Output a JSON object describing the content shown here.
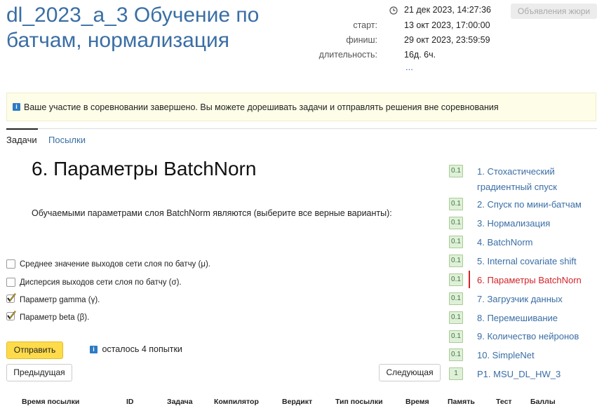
{
  "header": {
    "title": "dl_2023_a_3 Обучение по батчам, нормализация",
    "current_time": "21 дек 2023, 14:27:36",
    "start_label": "старт:",
    "start_value": "13 окт 2023, 17:00:00",
    "finish_label": "финиш:",
    "finish_value": "29 окт 2023, 23:59:59",
    "duration_label": "длительность:",
    "duration_value": "16д. 6ч.",
    "more": "...",
    "jury_button": "Объявления жюри"
  },
  "notice": {
    "text": "Ваше участие в соревновании завершено. Вы можете дорешивать задачи и отправлять решения вне соревнования"
  },
  "tabs": [
    {
      "label": "Задачи",
      "active": true
    },
    {
      "label": "Посылки",
      "active": false
    }
  ],
  "task": {
    "title": "6. Параметры BatchNorn",
    "question": "Обучаемыми параметрами слоя BatchNorm являются (выберите все верные варианты):",
    "options": [
      {
        "label": "Среднее значение выходов сети слоя по батчу (μ).",
        "checked": false
      },
      {
        "label": "Дисперсия выходов сети слоя по батчу (σ).",
        "checked": false
      },
      {
        "label": "Параметр gamma (γ).",
        "checked": true
      },
      {
        "label": "Параметр beta (β).",
        "checked": true
      }
    ],
    "submit_label": "Отправить",
    "attempts_text": "осталось 4 попытки",
    "prev_label": "Предыдущая",
    "next_label": "Следующая"
  },
  "sidebar": {
    "items": [
      {
        "score": "0.1",
        "label": "1. Стохастический градиентный спуск"
      },
      {
        "score": "0.1",
        "label": "2. Спуск по мини-батчам"
      },
      {
        "score": "0.1",
        "label": "3. Нормализация"
      },
      {
        "score": "0.1",
        "label": "4. BatchNorm"
      },
      {
        "score": "0.1",
        "label": "5. Internal covariate shift"
      },
      {
        "score": "0.1",
        "label": "6. Параметры BatchNorn",
        "active": true
      },
      {
        "score": "0.1",
        "label": "7. Загрузчик данных"
      },
      {
        "score": "0.1",
        "label": "8. Перемешивание"
      },
      {
        "score": "0.1",
        "label": "9. Количество нейронов"
      },
      {
        "score": "0.1",
        "label": "10. SimpleNet"
      },
      {
        "score": "1",
        "label": "P1. MSU_DL_HW_3"
      }
    ]
  },
  "table": {
    "headers": [
      "Время посылки",
      "ID",
      "Задача",
      "Компилятор",
      "Вердикт",
      "Тип посылки",
      "Время",
      "Память",
      "Тест",
      "Баллы"
    ]
  },
  "colors": {
    "link": "#3a6ea5",
    "active": "#d2232a",
    "submit": "#fddb4a",
    "notice_bg": "#fdfde8",
    "badge_bg": "#dff0d8"
  }
}
